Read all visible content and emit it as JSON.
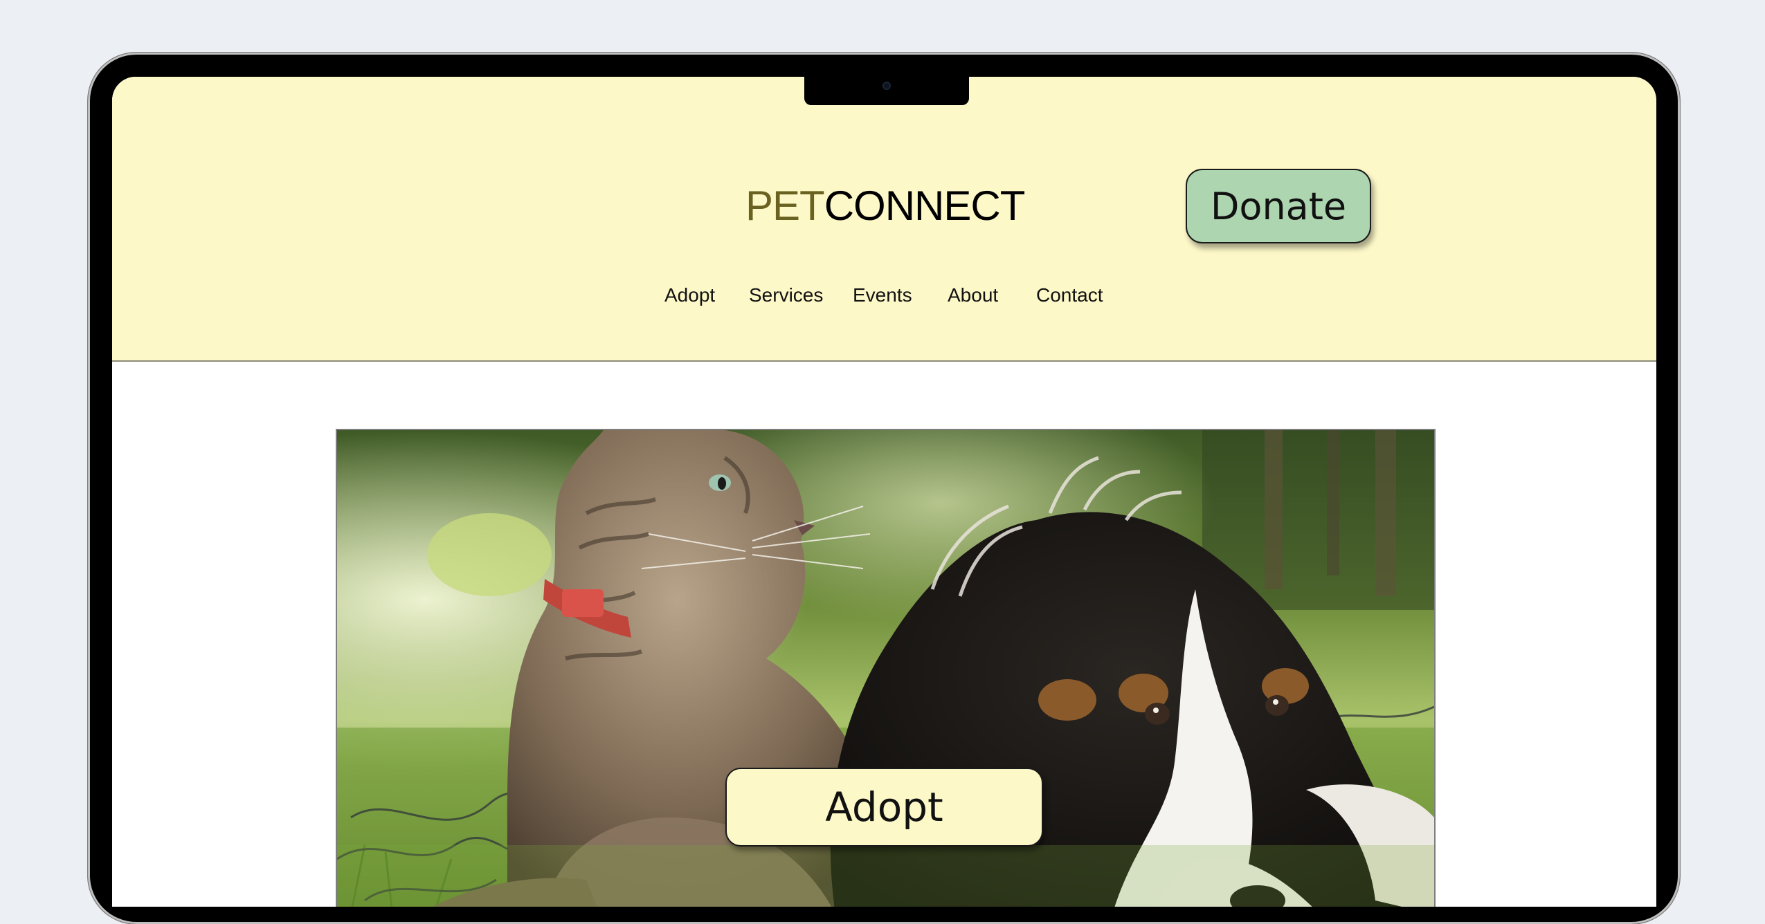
{
  "header": {
    "logo_pet": "PET",
    "logo_connect": "CONNECT",
    "donate_label": "Donate"
  },
  "nav": {
    "items": [
      "Adopt",
      "Services",
      "Events",
      "About",
      "Contact"
    ]
  },
  "hero": {
    "image_subject": "Cat and dog lying together on grass",
    "adopt_label": "Adopt"
  },
  "colors": {
    "page_background": "#eceff4",
    "header_background": "#fdf8c8",
    "logo_accent": "#6a6220",
    "donate_button": "#acd5b0",
    "adopt_button": "#fdf8c8"
  }
}
